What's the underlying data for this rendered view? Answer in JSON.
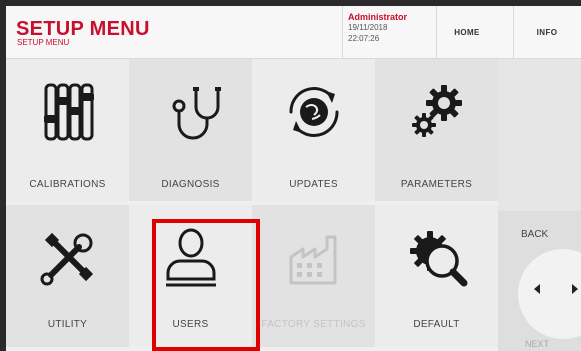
{
  "header": {
    "title": "SETUP MENU",
    "subtitle": "SETUP MENU",
    "user": {
      "name": "Administrator",
      "date": "19/11/2018",
      "time": "22:07:26"
    },
    "home_label": "HOME",
    "info_label": "INFO"
  },
  "tiles": [
    {
      "label": "CALIBRATIONS",
      "icon": "calibrations-icon",
      "enabled": true
    },
    {
      "label": "DIAGNOSIS",
      "icon": "stethoscope-icon",
      "enabled": true
    },
    {
      "label": "UPDATES",
      "icon": "updates-globe-icon",
      "enabled": true
    },
    {
      "label": "PARAMETERS",
      "icon": "gears-icon",
      "enabled": true
    },
    {
      "label": "UTILITY",
      "icon": "tools-icon",
      "enabled": true
    },
    {
      "label": "USERS",
      "icon": "user-icon",
      "enabled": true
    },
    {
      "label": "FACTORY SETTINGS",
      "icon": "factory-icon",
      "enabled": false
    },
    {
      "label": "DEFAULT",
      "icon": "gear-magnifier-icon",
      "enabled": true
    }
  ],
  "nav": {
    "back_label": "BACK",
    "next_label": "NEXT"
  },
  "colors": {
    "accent": "#c8102e",
    "highlight": "#e00000"
  }
}
